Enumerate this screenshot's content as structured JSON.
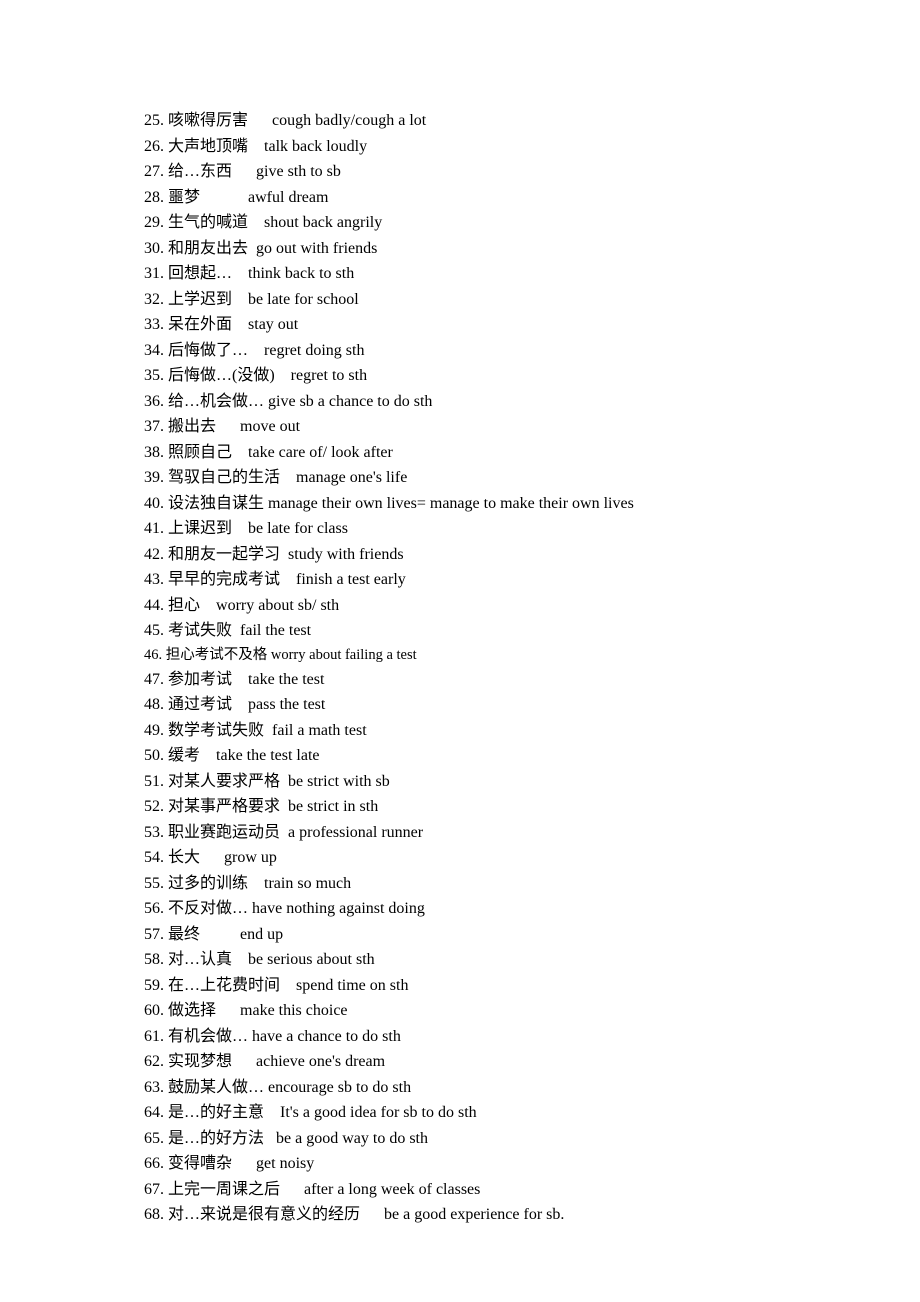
{
  "items": [
    {
      "num": "25.",
      "cn": "咳嗽得厉害",
      "gap": "      ",
      "en": "cough badly/cough a lot"
    },
    {
      "num": "26.",
      "cn": "大声地顶嘴",
      "gap": "    ",
      "en": "talk back loudly"
    },
    {
      "num": "27.",
      "cn": "给…东西",
      "gap": "      ",
      "en": "give sth to sb"
    },
    {
      "num": "28.",
      "cn": "噩梦",
      "gap": "            ",
      "en": "awful dream"
    },
    {
      "num": "29.",
      "cn": "生气的喊道",
      "gap": "    ",
      "en": "shout back angrily"
    },
    {
      "num": "30.",
      "cn": "和朋友出去",
      "gap": "  ",
      "en": "go out with friends"
    },
    {
      "num": "31.",
      "cn": "回想起…",
      "gap": "    ",
      "en": "think back to sth"
    },
    {
      "num": "32.",
      "cn": "上学迟到",
      "gap": "    ",
      "en": "be late for school"
    },
    {
      "num": "33.",
      "cn": "呆在外面",
      "gap": "    ",
      "en": "stay out"
    },
    {
      "num": "34.",
      "cn": "后悔做了…",
      "gap": "    ",
      "en": "regret doing sth"
    },
    {
      "num": "35.",
      "cn": "后悔做…(没做)",
      "gap": "    ",
      "en": "regret to sth"
    },
    {
      "num": "36.",
      "cn": "给…机会做…",
      "gap": " ",
      "en": "give sb a chance to do sth"
    },
    {
      "num": "37.",
      "cn": "搬出去",
      "gap": "      ",
      "en": "move out"
    },
    {
      "num": "38.",
      "cn": "照顾自己",
      "gap": "    ",
      "en": "take care of/ look after"
    },
    {
      "num": "39.",
      "cn": "驾驭自己的生活",
      "gap": "    ",
      "en": "manage one's life"
    },
    {
      "num": "40.",
      "cn": "设法独自谋生",
      "gap": " ",
      "en": "manage their own lives= manage to make their own lives"
    },
    {
      "num": "41.",
      "cn": "上课迟到",
      "gap": "    ",
      "en": "be late for class"
    },
    {
      "num": "42.",
      "cn": "和朋友一起学习",
      "gap": "  ",
      "en": "study with friends"
    },
    {
      "num": "43.",
      "cn": "早早的完成考试",
      "gap": "    ",
      "en": "finish a test early"
    },
    {
      "num": "44.",
      "cn": "担心",
      "gap": "    ",
      "en": "worry about sb/ sth"
    },
    {
      "num": "45.",
      "cn": "考试失败",
      "gap": "  ",
      "en": "fail the test"
    },
    {
      "num": "46.",
      "cn": "担心考试不及格",
      "gap": " ",
      "en": "worry about failing a test",
      "small": true
    },
    {
      "num": "47.",
      "cn": "参加考试",
      "gap": "    ",
      "en": "take the test"
    },
    {
      "num": "48.",
      "cn": "通过考试",
      "gap": "    ",
      "en": "pass the test"
    },
    {
      "num": "49.",
      "cn": "数学考试失败",
      "gap": "  ",
      "en": "fail a math test"
    },
    {
      "num": "50.",
      "cn": "缓考",
      "gap": "    ",
      "en": "take the test late"
    },
    {
      "num": "51.",
      "cn": "对某人要求严格",
      "gap": "  ",
      "en": "be strict with sb"
    },
    {
      "num": "52.",
      "cn": "对某事严格要求",
      "gap": "  ",
      "en": "be strict in sth"
    },
    {
      "num": "53.",
      "cn": "职业赛跑运动员",
      "gap": "  ",
      "en": "a professional runner"
    },
    {
      "num": "54.",
      "cn": "长大",
      "gap": "      ",
      "en": "grow up"
    },
    {
      "num": "55.",
      "cn": "过多的训练",
      "gap": "    ",
      "en": "train so much"
    },
    {
      "num": "56.",
      "cn": "不反对做…",
      "gap": " ",
      "en": "have nothing against doing"
    },
    {
      "num": "57.",
      "cn": "最终",
      "gap": "          ",
      "en": "end up"
    },
    {
      "num": "58.",
      "cn": "对…认真",
      "gap": "    ",
      "en": "be serious about sth"
    },
    {
      "num": "59.",
      "cn": "在…上花费时间",
      "gap": "    ",
      "en": "spend time on sth"
    },
    {
      "num": "60.",
      "cn": "做选择",
      "gap": "      ",
      "en": "make this choice"
    },
    {
      "num": "61.",
      "cn": "有机会做…",
      "gap": " ",
      "en": "have a chance to do sth"
    },
    {
      "num": "62.",
      "cn": "实现梦想",
      "gap": "      ",
      "en": "achieve one's dream"
    },
    {
      "num": "63.",
      "cn": "鼓励某人做…",
      "gap": " ",
      "en": "encourage sb to do sth"
    },
    {
      "num": "64.",
      "cn": "是…的好主意",
      "gap": "    ",
      "en": "It's a good idea for sb to do sth"
    },
    {
      "num": "65.",
      "cn": "是…的好方法",
      "gap": "   ",
      "en": "be a good way to do sth"
    },
    {
      "num": "66.",
      "cn": "变得嘈杂",
      "gap": "      ",
      "en": "get noisy"
    },
    {
      "num": "67.",
      "cn": "上完一周课之后",
      "gap": "      ",
      "en": "after a long week of classes"
    },
    {
      "num": "68.",
      "cn": "对…来说是很有意义的经历",
      "gap": "      ",
      "en": "be a good experience for sb."
    }
  ]
}
